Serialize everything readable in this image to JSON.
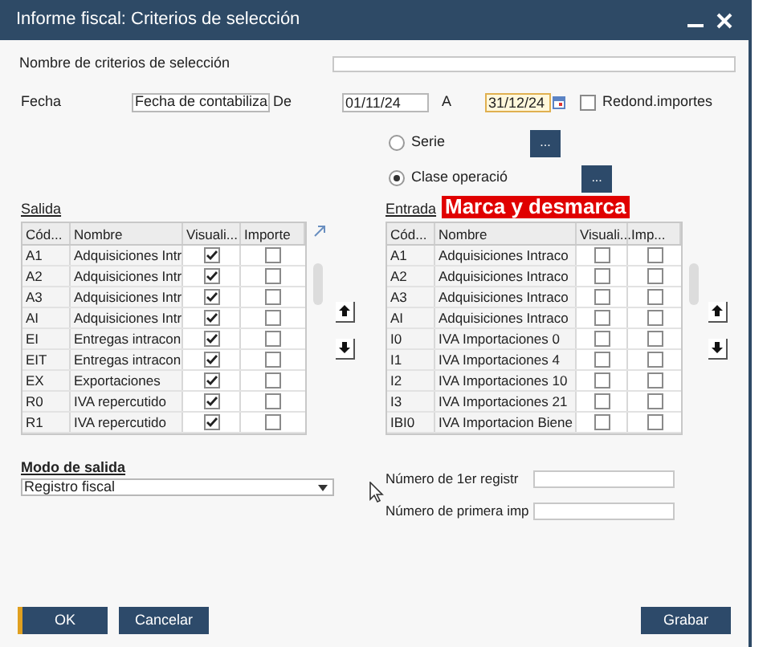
{
  "window": {
    "title": "Informe fiscal: Criterios de selección"
  },
  "criteria_name": {
    "label": "Nombre de criterios de selección"
  },
  "date": {
    "label": "Fecha",
    "type": "Fecha de contabiliza",
    "from_label": "De",
    "from": "01/11/24",
    "to_label": "A",
    "to": "31/12/24"
  },
  "round_amounts": {
    "label": "Redond.importes",
    "checked": false
  },
  "options": [
    {
      "label": "Serie",
      "selected": false,
      "button": "..."
    },
    {
      "label": "Clase operació",
      "selected": true,
      "button": "..."
    }
  ],
  "overlay": {
    "text": "Marca y desmarca"
  },
  "tables": [
    {
      "title": "Salida",
      "columns": [
        "Cód...",
        "Nombre",
        "Visuali...",
        "Importe"
      ],
      "rows": [
        {
          "code": "A1",
          "name": "Adquisiciones Intr",
          "visualize": true,
          "amount": false
        },
        {
          "code": "A2",
          "name": "Adquisiciones Intr",
          "visualize": true,
          "amount": false
        },
        {
          "code": "A3",
          "name": "Adquisiciones Intr",
          "visualize": true,
          "amount": false
        },
        {
          "code": "AI",
          "name": "Adquisiciones Intr",
          "visualize": true,
          "amount": false
        },
        {
          "code": "EI",
          "name": "Entregas intracon",
          "visualize": true,
          "amount": false
        },
        {
          "code": "EIT",
          "name": "Entregas intracon",
          "visualize": true,
          "amount": false
        },
        {
          "code": "EX",
          "name": "Exportaciones",
          "visualize": true,
          "amount": false
        },
        {
          "code": "R0",
          "name": "IVA repercutido",
          "visualize": true,
          "amount": false
        },
        {
          "code": "R1",
          "name": "IVA repercutido",
          "visualize": true,
          "amount": false
        }
      ]
    },
    {
      "title": "Entrada",
      "columns": [
        "Cód...",
        "Nombre",
        "Visuali...",
        "Imp..."
      ],
      "rows": [
        {
          "code": "A1",
          "name": "Adquisiciones Intraco",
          "visualize": false,
          "amount": false
        },
        {
          "code": "A2",
          "name": "Adquisiciones Intraco",
          "visualize": false,
          "amount": false
        },
        {
          "code": "A3",
          "name": "Adquisiciones Intraco",
          "visualize": false,
          "amount": false
        },
        {
          "code": "AI",
          "name": "Adquisiciones Intraco",
          "visualize": false,
          "amount": false
        },
        {
          "code": "I0",
          "name": "IVA Importaciones 0",
          "visualize": false,
          "amount": false
        },
        {
          "code": "I1",
          "name": "IVA Importaciones 4",
          "visualize": false,
          "amount": false
        },
        {
          "code": "I2",
          "name": "IVA Importaciones 10",
          "visualize": false,
          "amount": false
        },
        {
          "code": "I3",
          "name": "IVA Importaciones 21",
          "visualize": false,
          "amount": false
        },
        {
          "code": "IBI0",
          "name": "IVA Importacion Biene",
          "visualize": false,
          "amount": false
        }
      ]
    }
  ],
  "output_mode": {
    "title": "Modo de salida",
    "value": "Registro fiscal"
  },
  "numbers": [
    {
      "label": "Número de 1er registr"
    },
    {
      "label": "Número de primera imp"
    }
  ],
  "buttons": [
    {
      "label": "OK",
      "default": true
    },
    {
      "label": "Cancelar",
      "default": false
    },
    {
      "label": "Grabar",
      "default": false
    }
  ]
}
